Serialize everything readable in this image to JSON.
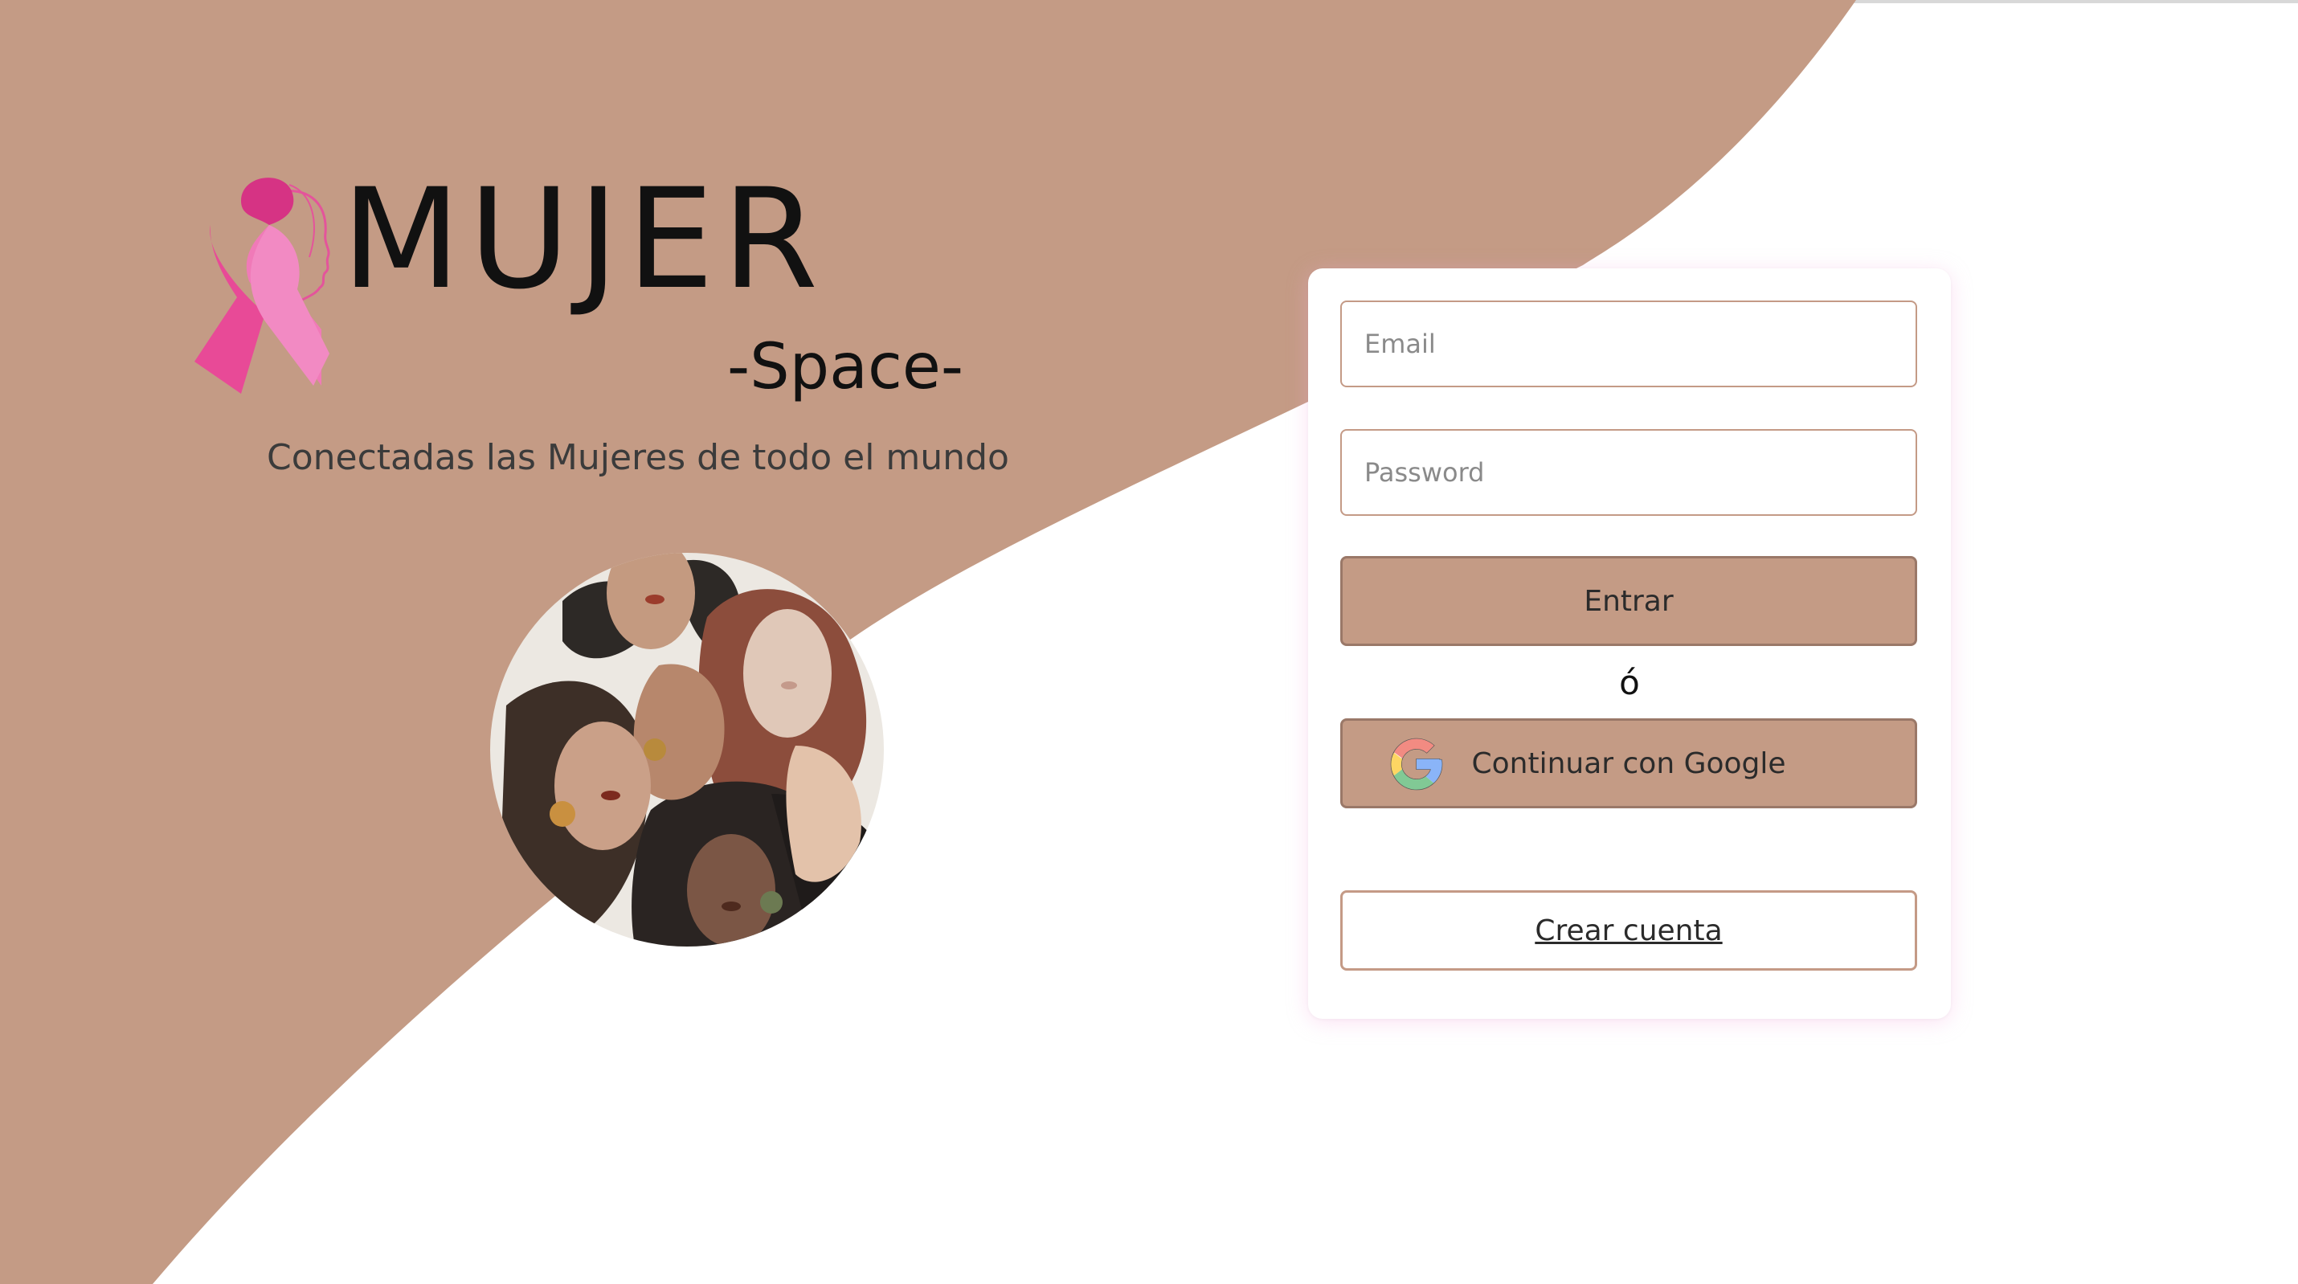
{
  "brand": {
    "title": "MUJER",
    "subtitle": "-Space-",
    "tagline": "Conectadas las Mujeres de todo el mundo"
  },
  "login": {
    "email_placeholder": "Email",
    "password_placeholder": "Password",
    "submit_label": "Entrar",
    "separator": "ó",
    "google_label": "Continuar con Google",
    "create_account_label": "Crear cuenta"
  },
  "icons": {
    "logo": "pink-ribbon-woman-profile-icon",
    "illustration": "diverse-women-faces-illustration",
    "google": "google-icon"
  },
  "colors": {
    "accent_tan": "#c49b85",
    "button_border": "#9a7868",
    "ribbon_pink": "#f07ab8",
    "ribbon_dark_pink": "#d63384",
    "background": "#ffffff"
  }
}
